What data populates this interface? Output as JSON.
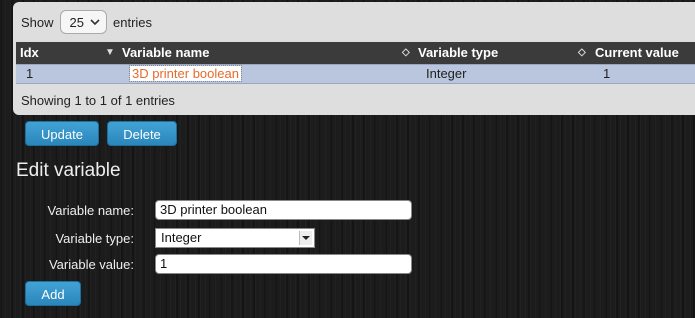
{
  "table": {
    "show_label": "Show",
    "page_length": "25",
    "entries_label": "entries",
    "columns": [
      "Idx",
      "Variable name",
      "Variable type",
      "Current value"
    ],
    "rows": [
      {
        "idx": "1",
        "name": "3D printer boolean",
        "type": "Integer",
        "value": "1"
      }
    ],
    "info": "Showing 1 to 1 of 1 entries"
  },
  "actions": {
    "update_label": "Update",
    "delete_label": "Delete"
  },
  "form": {
    "title": "Edit variable",
    "name_label": "Variable name:",
    "name_value": "3D printer boolean",
    "type_label": "Variable type:",
    "type_value": "Integer",
    "value_label": "Variable value:",
    "value_value": "1",
    "add_label": "Add"
  }
}
